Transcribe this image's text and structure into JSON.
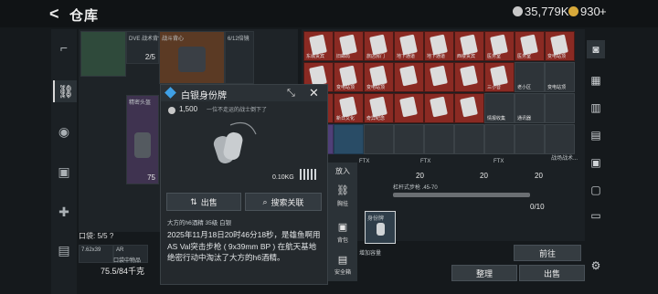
{
  "header": {
    "back_glyph": "<",
    "title": "仓库",
    "currency_silver": "35,779K",
    "currency_gold": "930",
    "currency_plus": "+"
  },
  "rail": {
    "items": [
      "pistol-icon",
      "vest-icon",
      "helmet-icon",
      "backpack-icon",
      "medkit-icon",
      "case-icon"
    ]
  },
  "left_inventory": {
    "tiles": [
      {
        "label": "DVE 战术背包",
        "count": "2/5"
      },
      {
        "label": "战斗背心",
        "count": ""
      },
      {
        "label": "6/12倍镜",
        "count": ""
      },
      {
        "label": "精密头盔",
        "count": ""
      },
      {
        "label": "",
        "count": "75"
      }
    ],
    "pocket_label": "口袋: 5/5",
    "pocket_help": "?",
    "weight": "75.5",
    "weight_max": "/84千克",
    "small_items": [
      "7.62x39",
      "AR",
      "口袋中物品"
    ]
  },
  "storage": {
    "cell_labels": [
      "东城贵宾",
      "旧邮局",
      "旅店房门",
      "地下通道",
      "地下通道",
      "西楼贵宾",
      "医务室",
      "医务室",
      "变电站顶",
      "变电站顶",
      "变电站顶",
      "变电站顶",
      "",
      "",
      "",
      "三小音",
      "老小区",
      "变电站顶",
      "变电站顶",
      "新日文化",
      "奇异纪念",
      "",
      "",
      "",
      "情报收集",
      "通讯器",
      "",
      "",
      "",
      "",
      "",
      ""
    ],
    "ftx_labels": [
      "FTX",
      "FTX",
      "FTX"
    ],
    "counts": [
      "20",
      "20",
      "20"
    ],
    "rifle_label": "杠杆式步枪 .45-70",
    "capacity": "0/10",
    "selected_label": "身份牌",
    "add_capacity": "增加容量",
    "more_label": "战场战术..."
  },
  "popup": {
    "title": "白银身份牌",
    "price": "1,500",
    "quote": "一位不走运的战士倒下了",
    "weight": "0.10KG",
    "sell_label": "出售",
    "search_label": "搜索关联",
    "meta": "大方的h6酒精 35级 白银",
    "description": "2025年11月18日20时46分18秒，是雄鱼啊用AS Val突击步枪 ( 9x39mm BP ) 在航天基地绝密行动中淘汰了大方的h6酒精。"
  },
  "popup_side": {
    "put_in": "放入",
    "chest_rig": "胸挂",
    "backpack": "背包",
    "safe_box": "安全箱"
  },
  "bottom": {
    "organize": "整理",
    "sell": "出售",
    "goto": "前往"
  },
  "colors": {
    "accent_red": "#8a2a23",
    "accent_blue": "#3fa0e6",
    "gold": "#d8a93a",
    "silver": "#c8c8c8"
  }
}
